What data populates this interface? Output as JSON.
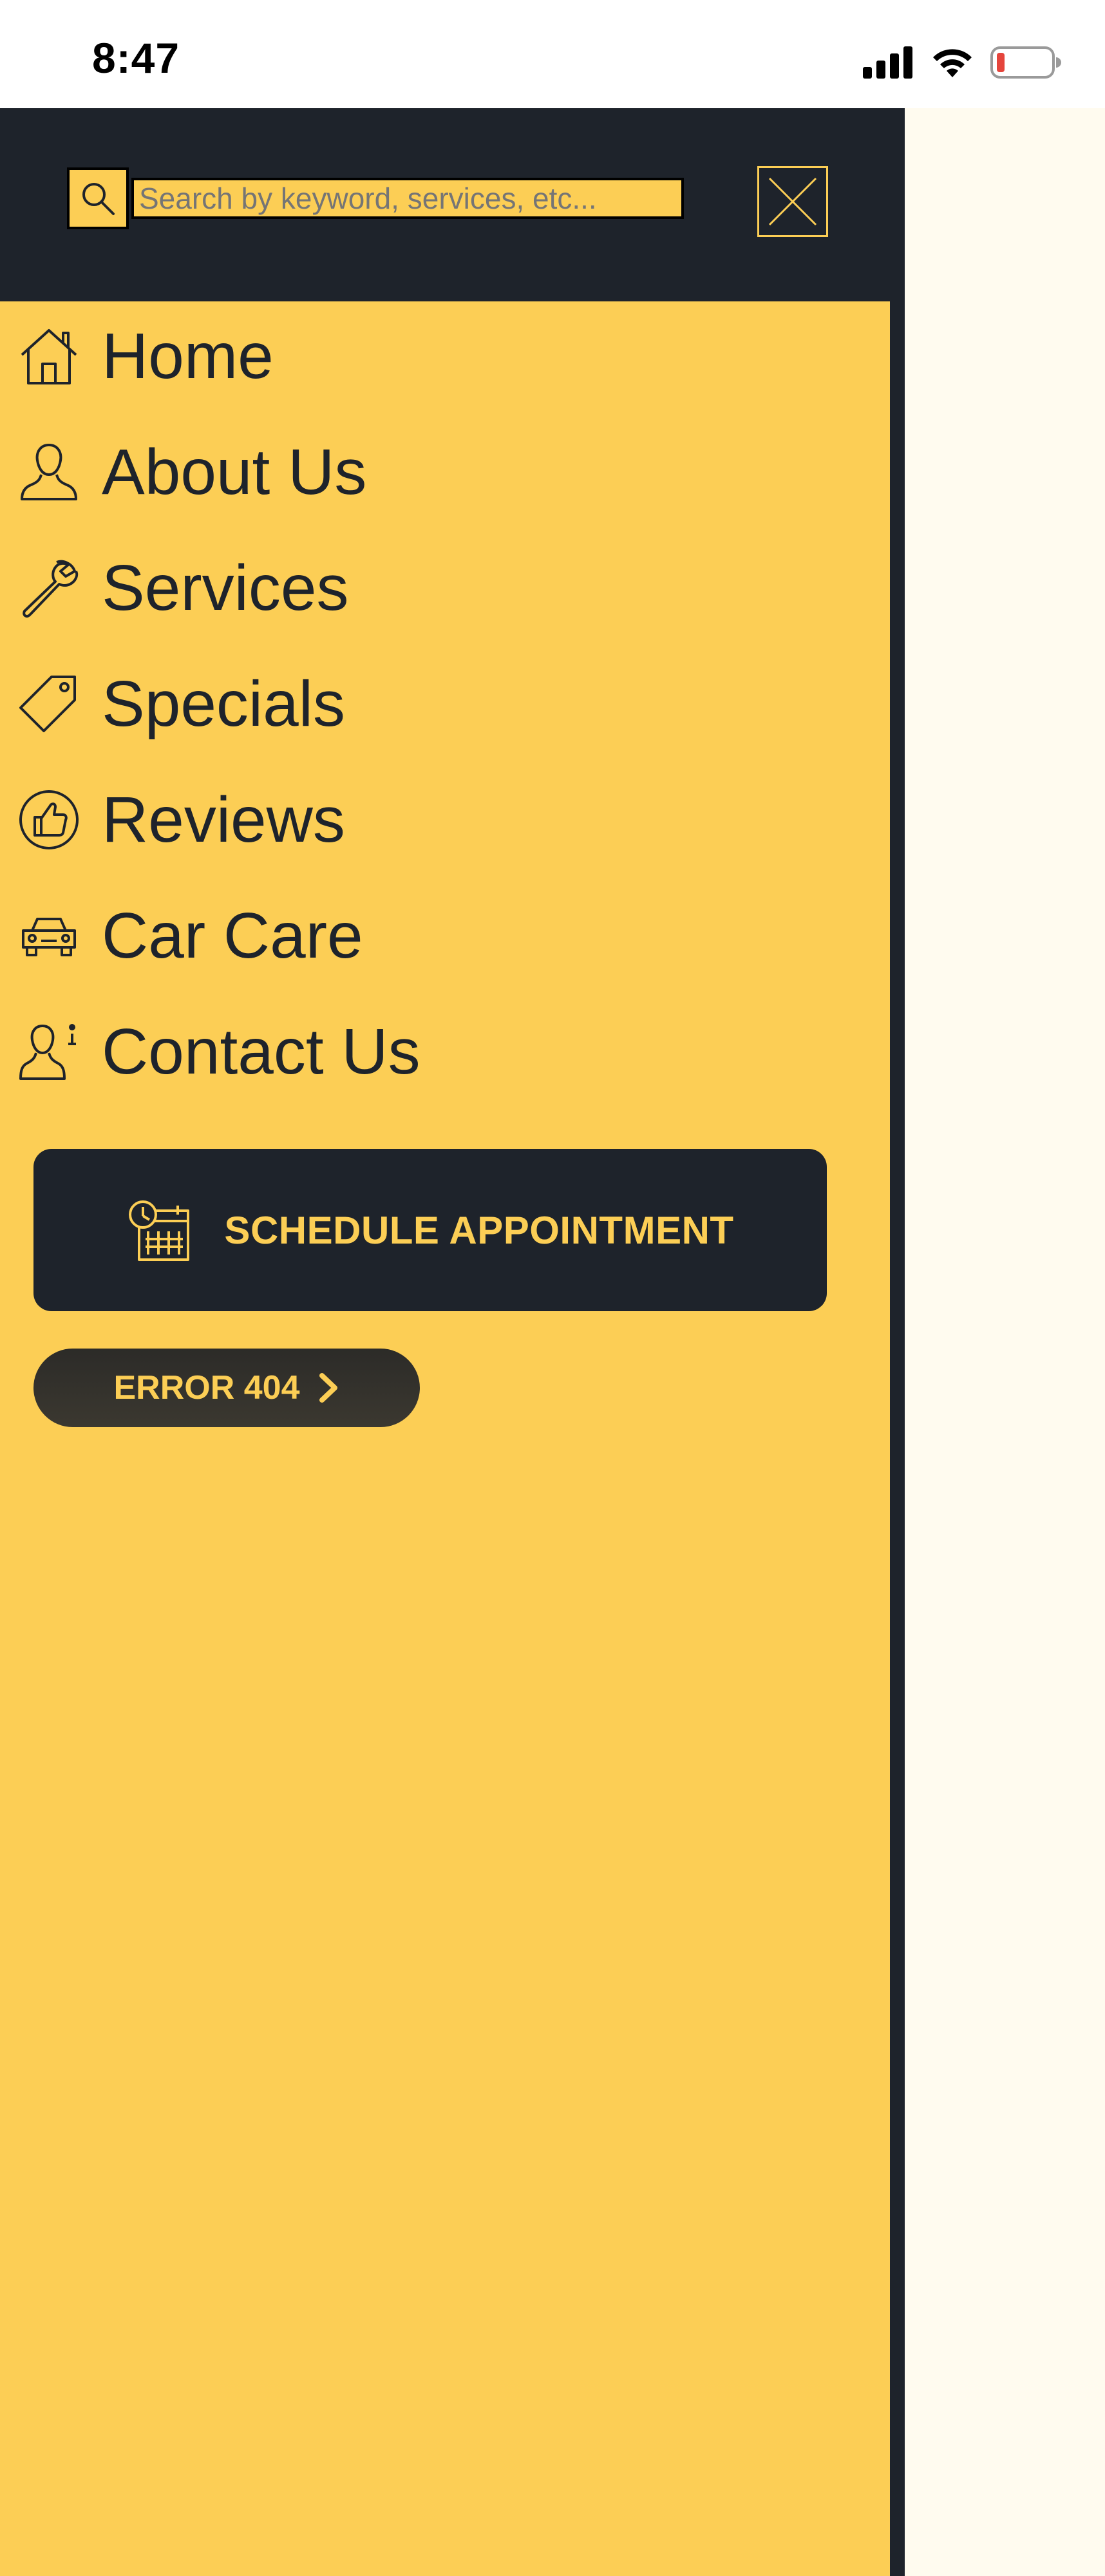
{
  "status_bar": {
    "time": "8:47",
    "icons": [
      "signal-icon",
      "wifi-icon",
      "battery-low-icon"
    ]
  },
  "menu": {
    "search": {
      "placeholder": "Search by keyword, services, etc...",
      "value": "",
      "icon": "search-icon"
    },
    "close_icon": "close-icon",
    "items": [
      {
        "label": "Home",
        "icon": "home-icon"
      },
      {
        "label": "About Us",
        "icon": "user-icon"
      },
      {
        "label": "Services",
        "icon": "wrench-icon"
      },
      {
        "label": "Specials",
        "icon": "tag-icon"
      },
      {
        "label": "Reviews",
        "icon": "thumbs-up-icon"
      },
      {
        "label": "Car Care",
        "icon": "car-icon"
      },
      {
        "label": "Contact Us",
        "icon": "contact-info-icon"
      }
    ],
    "schedule_button": {
      "label": "SCHEDULE APPOINTMENT",
      "icon": "calendar-clock-icon"
    },
    "error_button": {
      "label": "ERROR 404",
      "icon": "chevron-right-icon"
    }
  },
  "colors": {
    "accent_yellow": "#fcce55",
    "dark": "#1e232b",
    "page_background": "#fffbef"
  }
}
